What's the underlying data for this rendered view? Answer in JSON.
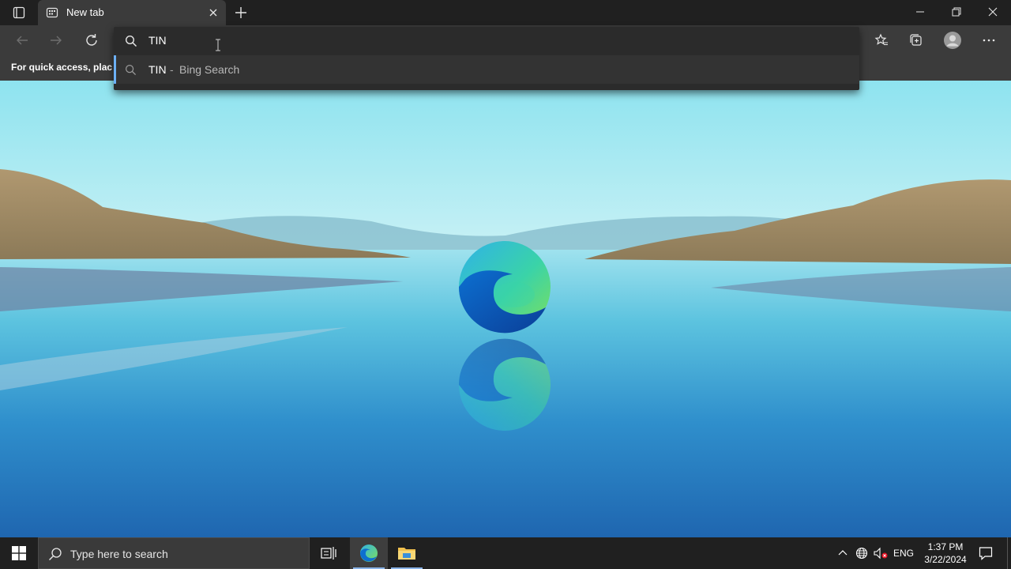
{
  "tab": {
    "title": "New tab"
  },
  "address_bar": {
    "typed_text": "TIN",
    "suggestion": {
      "query": "TIN",
      "separator": "-",
      "source": "Bing Search"
    }
  },
  "favorites_bar": {
    "hint": "For quick access, place y"
  },
  "taskbar": {
    "search_placeholder": "Type here to search",
    "language": "ENG",
    "time": "1:37 PM",
    "date": "3/22/2024",
    "apps": [
      "task-view-icon",
      "edge-icon",
      "file-explorer-icon"
    ]
  },
  "colors": {
    "chrome_dark": "#202020",
    "toolbar": "#3b3b3b",
    "suggestion_accent": "#6cb0f5",
    "taskbar": "#202020"
  }
}
